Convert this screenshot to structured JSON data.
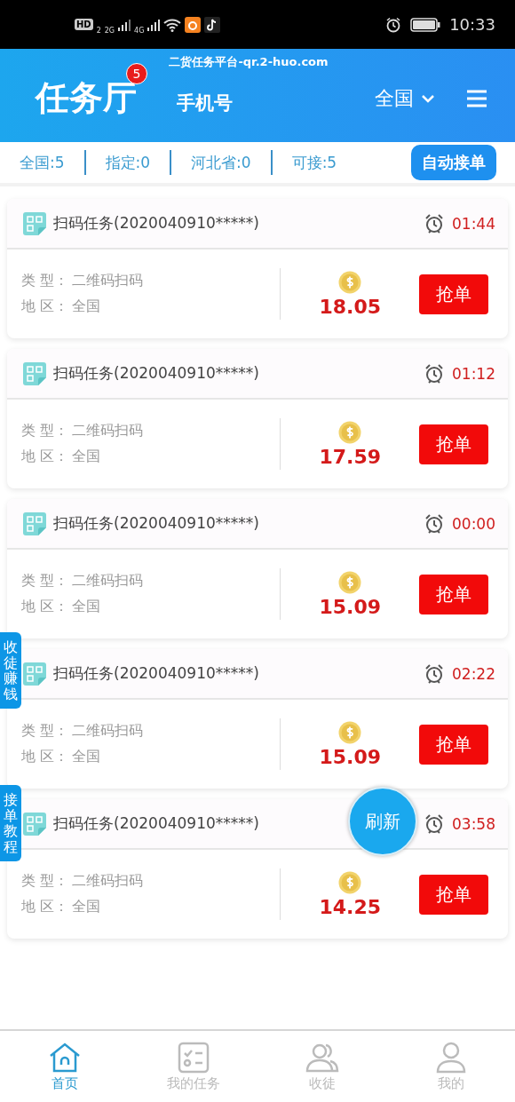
{
  "status_bar": {
    "network_labels": [
      "HD",
      "2",
      "2G",
      "4G"
    ],
    "time": "10:33"
  },
  "header": {
    "site": "二货任务平台-qr.2-huo.com",
    "title": "任务厅",
    "badge": "5",
    "tab": "手机号",
    "region": "全国"
  },
  "filters": [
    {
      "label": "全国:5"
    },
    {
      "label": "指定:0"
    },
    {
      "label": "河北省:0"
    },
    {
      "label": "可接:5"
    }
  ],
  "auto_button": "自动接单",
  "tasks": [
    {
      "title": "扫码任务(2020040910*****)",
      "timer": "01:44",
      "type_label": "类 型：",
      "type": "二维码扫码",
      "area_label": "地 区：",
      "area": "全国",
      "amount": "18.05",
      "action": "抢单"
    },
    {
      "title": "扫码任务(2020040910*****)",
      "timer": "01:12",
      "type_label": "类 型：",
      "type": "二维码扫码",
      "area_label": "地 区：",
      "area": "全国",
      "amount": "17.59",
      "action": "抢单"
    },
    {
      "title": "扫码任务(2020040910*****)",
      "timer": "00:00",
      "type_label": "类 型：",
      "type": "二维码扫码",
      "area_label": "地 区：",
      "area": "全国",
      "amount": "15.09",
      "action": "抢单"
    },
    {
      "title": "扫码任务(2020040910*****)",
      "timer": "02:22",
      "type_label": "类 型：",
      "type": "二维码扫码",
      "area_label": "地 区：",
      "area": "全国",
      "amount": "15.09",
      "action": "抢单"
    },
    {
      "title": "扫码任务(2020040910*****)",
      "timer": "03:58",
      "type_label": "类 型：",
      "type": "二维码扫码",
      "area_label": "地 区：",
      "area": "全国",
      "amount": "14.25",
      "action": "抢单"
    }
  ],
  "side_tabs": [
    "收徒赚钱",
    "接单教程"
  ],
  "refresh": "刷新",
  "nav": [
    {
      "label": "首页",
      "kind": "home",
      "selected": true
    },
    {
      "label": "我的任务",
      "kind": "checklist",
      "selected": false
    },
    {
      "label": "收徒",
      "kind": "people",
      "selected": false
    },
    {
      "label": "我的",
      "kind": "person",
      "selected": false
    }
  ]
}
